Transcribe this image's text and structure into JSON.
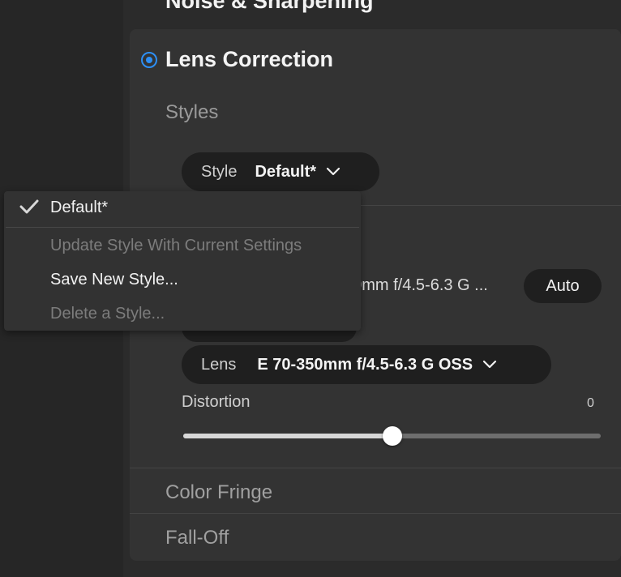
{
  "panel": {
    "previous_section_title": "Noise & Sharpening",
    "title": "Lens Correction",
    "styles_heading": "Styles",
    "style_selector": {
      "label": "Style",
      "value": "Default*"
    },
    "profile_row": {
      "partial_text": "50mm f/4.5-6.3 G ...",
      "auto_label": "Auto"
    },
    "lens_selector": {
      "label": "Lens",
      "value": "E 70-350mm f/4.5-6.3 G OSS"
    },
    "distortion": {
      "label": "Distortion",
      "value": "0",
      "slider_fraction": 0.5
    },
    "collapsed_sections": [
      "Color Fringe",
      "Fall-Off"
    ]
  },
  "style_menu": {
    "selected_item": "Default*",
    "items": [
      {
        "label": "Update Style With Current Settings",
        "enabled": false
      },
      {
        "label": "Save New Style...",
        "enabled": true
      },
      {
        "label": "Delete a Style...",
        "enabled": false
      }
    ]
  },
  "colors": {
    "accent": "#2d8ff5",
    "card_background": "#333333",
    "pill_background": "#1f1f1f"
  },
  "icons": {
    "radio": "radio-selected-icon",
    "dropdown": "chevron-down-icon",
    "check": "checkmark-icon"
  }
}
